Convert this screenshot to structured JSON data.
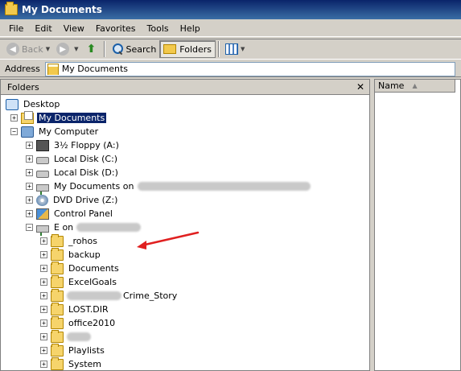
{
  "window": {
    "title": "My Documents"
  },
  "menu": [
    "File",
    "Edit",
    "View",
    "Favorites",
    "Tools",
    "Help"
  ],
  "toolbar": {
    "back_label": "Back",
    "search_label": "Search",
    "folders_label": "Folders"
  },
  "address": {
    "label": "Address",
    "value": "My Documents"
  },
  "folders_pane": {
    "title": "Folders",
    "items": {
      "desktop": "Desktop",
      "my_documents": "My Documents",
      "my_computer": "My Computer",
      "floppy": "3½ Floppy (A:)",
      "local_c": "Local Disk (C:)",
      "local_d": "Local Disk (D:)",
      "mydocs_on": "My Documents on",
      "dvd": "DVD Drive (Z:)",
      "control_panel": "Control Panel",
      "e_on": "E on",
      "rohos": "_rohos",
      "backup": "backup",
      "documents": "Documents",
      "excelgoals": "ExcelGoals",
      "crime_story": "Crime_Story",
      "lost_dir": "LOST.DIR",
      "office2010": "office2010",
      "playlists": "Playlists",
      "system": "System"
    }
  },
  "list_pane": {
    "col_name": "Name"
  },
  "colors": {
    "selection": "#0a246a",
    "annotation_arrow": "#e02020",
    "titlebar": "#0a246a"
  }
}
